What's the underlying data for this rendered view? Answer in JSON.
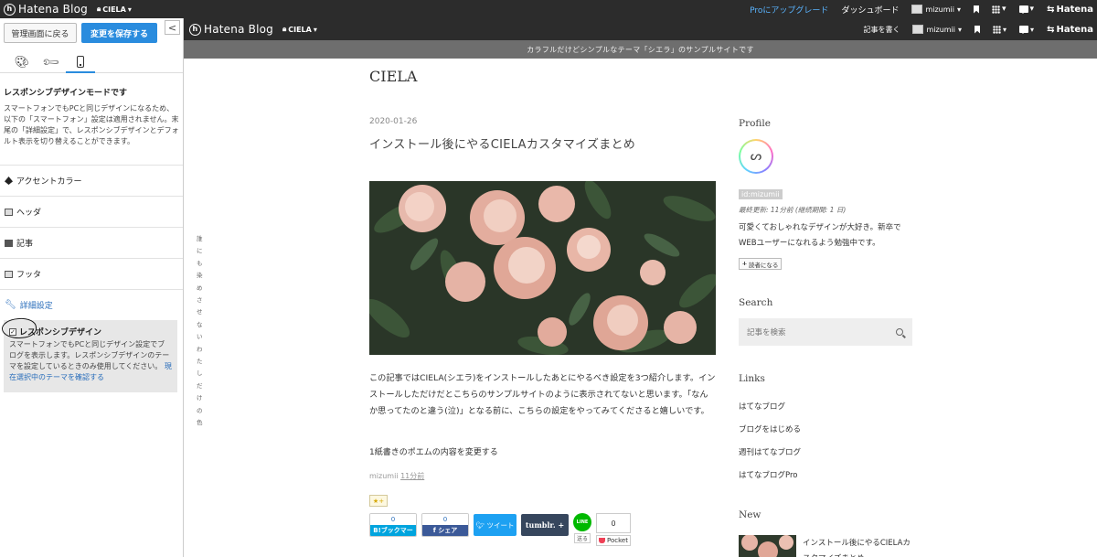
{
  "topbar": {
    "logo": "Hatena Blog",
    "blog_name": "CIELA",
    "pro_upgrade": "Proにアップグレード",
    "dashboard": "ダッシュボード",
    "username": "mizumii",
    "hatena": "Hatena"
  },
  "sidebar": {
    "back_label": "管理画面に戻る",
    "save_label": "変更を保存する",
    "collapse": "<",
    "tabs": [
      {
        "icon": "palette-icon"
      },
      {
        "icon": "wrench-icon"
      },
      {
        "icon": "smartphone-icon",
        "active": true
      }
    ],
    "info_title": "レスポンシブデザインモードです",
    "info_text": "スマートフォンでもPCと同じデザインになるため、以下の「スマートフォン」設定は適用されません。末尾の「詳細設定」で、レスポンシブデザインとデフォルト表示を切り替えることができます。",
    "sections": [
      {
        "label": "アクセントカラー",
        "icon": "paint-drop-icon"
      },
      {
        "label": "ヘッダ",
        "icon": "header-icon"
      },
      {
        "label": "記事",
        "icon": "article-icon"
      },
      {
        "label": "フッタ",
        "icon": "footer-icon"
      }
    ],
    "advanced_label": "詳細設定",
    "responsive_label": "レスポンシブデザイン",
    "responsive_checked": true,
    "responsive_desc": "スマートフォンでもPCと同じデザイン設定でブログを表示します。レスポンシブデザインのテーマを設定しているときのみ使用してください。",
    "responsive_link": "現在選択中のテーマを確認する"
  },
  "preview": {
    "bar": {
      "logo": "Hatena Blog",
      "blog_name": "CIELA",
      "write": "記事を書く",
      "username": "mizumii",
      "hatena": "Hatena"
    },
    "banner": "カラフルだけどシンプルなテーマ「シエラ」のサンプルサイトです",
    "vertical_text": "誰にも染めさせないわたしだけの色",
    "site_title": "CIELA",
    "post": {
      "date": "2020-01-26",
      "title": "インストール後にやるCIELAカスタマイズまとめ",
      "body": "この記事ではCIELA(シエラ)をインストールしたあとにやるべき設定を3つ紹介します。インストールしただけだとこちらのサンプルサイトのように表示されてないと思います。「なんか思ってたのと違う(泣)」となる前に、こちらの設定をやってみてくださると嬉しいです。",
      "subtitle": "1紙書きのポエムの内容を変更する",
      "author": "mizumii",
      "time": "11分前",
      "star": "★+",
      "share": {
        "hatebu_count": "0",
        "hatebu_label": "B!ブックマーク",
        "facebook_count": "0",
        "facebook_label": "シェア",
        "tweet_label": "ツイート",
        "tumblr_label": "tumblr.",
        "line_label": "LINE",
        "line_send": "送る",
        "pocket_count": "0",
        "pocket_label": "Pocket"
      }
    },
    "side": {
      "profile_heading": "Profile",
      "profile_id": "id:mizumii",
      "profile_updated": "最終更新: 11分前 (継続期間: 1 日)",
      "profile_desc": "可愛くておしゃれなデザインが大好き。新卒でWEBユーザーになれるよう勉強中です。",
      "reader_label": "読者になる",
      "search_heading": "Search",
      "search_placeholder": "記事を検索",
      "links_heading": "Links",
      "links": [
        "はてなブログ",
        "ブログをはじめる",
        "週刊はてなブログ",
        "はてなブログPro"
      ],
      "new_heading": "New",
      "new_title": "インストール後にやるCIELAカスタマイズまとめ"
    }
  },
  "colors": {
    "accent_blue": "#2a8cde",
    "topbar": "#2c2c2c",
    "banner": "#6e6e6e",
    "pro_link": "#5ab4ff"
  }
}
